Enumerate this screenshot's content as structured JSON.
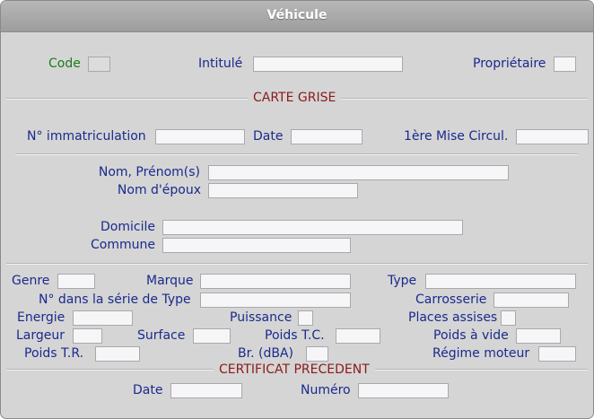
{
  "window": {
    "title": "Véhicule"
  },
  "top": {
    "code": "Code",
    "intitule": "Intitulé",
    "proprietaire": "Propriétaire"
  },
  "carte_grise": {
    "title": "CARTE GRISE",
    "immatriculation": "N° immatriculation",
    "date": "Date",
    "mise_circul": "1ère Mise Circul.",
    "nom_prenom": "Nom, Prénom(s)",
    "nom_epoux": "Nom d'époux",
    "domicile": "Domicile",
    "commune": "Commune",
    "genre": "Genre",
    "marque": "Marque",
    "type": "Type",
    "serie_type": "N° dans la série de Type",
    "carrosserie": "Carrosserie",
    "energie": "Energie",
    "puissance": "Puissance",
    "places_assises": "Places assises",
    "largeur": "Largeur",
    "surface": "Surface",
    "poids_tc": "Poids T.C.",
    "poids_vide": "Poids à vide",
    "poids_tr": "Poids T.R.",
    "br_dba": "Br. (dBA)",
    "regime_moteur": "Régime moteur"
  },
  "certificat": {
    "title": "CERTIFICAT PRECEDENT",
    "date": "Date",
    "numero": "Numéro"
  }
}
